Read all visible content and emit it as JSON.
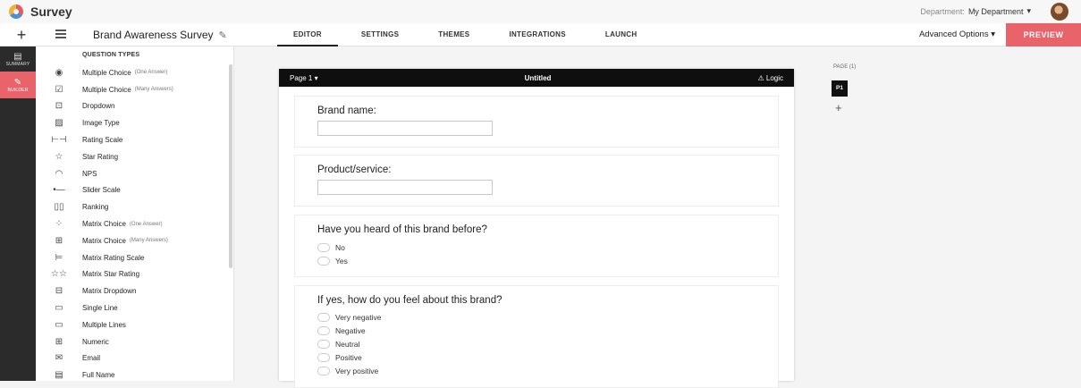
{
  "app": {
    "name": "Survey",
    "department_label": "Department:",
    "department_value": "My Department",
    "department_caret": "▾"
  },
  "navbar": {
    "add_glyph": "+",
    "survey_title": "Brand Awareness Survey",
    "edit_glyph": "✎",
    "tabs": [
      {
        "label": "EDITOR",
        "active": true
      },
      {
        "label": "SETTINGS",
        "active": false
      },
      {
        "label": "THEMES",
        "active": false
      },
      {
        "label": "INTEGRATIONS",
        "active": false
      },
      {
        "label": "LAUNCH",
        "active": false
      }
    ],
    "advanced_options": "Advanced Options ▾",
    "preview_label": "PREVIEW"
  },
  "rail": {
    "items": [
      {
        "label": "SUMMARY",
        "glyph": "▤",
        "active": false
      },
      {
        "label": "BUILDER",
        "glyph": "✎",
        "active": true
      }
    ]
  },
  "question_types": {
    "heading": "QUESTION TYPES",
    "items": [
      {
        "icon": "◉",
        "label": "Multiple Choice",
        "hint": "(One Answer)"
      },
      {
        "icon": "☑",
        "label": "Multiple Choice",
        "hint": "(Many Answers)"
      },
      {
        "icon": "⊡",
        "label": "Dropdown",
        "hint": ""
      },
      {
        "icon": "▨",
        "label": "Image Type",
        "hint": ""
      },
      {
        "icon": "⊢⊣",
        "label": "Rating Scale",
        "hint": ""
      },
      {
        "icon": "☆",
        "label": "Star Rating",
        "hint": ""
      },
      {
        "icon": "◠",
        "label": "NPS",
        "hint": ""
      },
      {
        "icon": "•—",
        "label": "Slider Scale",
        "hint": ""
      },
      {
        "icon": "▯▯",
        "label": "Ranking",
        "hint": ""
      },
      {
        "icon": "⁘",
        "label": "Matrix Choice",
        "hint": "(One Answer)"
      },
      {
        "icon": "⊞",
        "label": "Matrix Choice",
        "hint": "(Many Answers)"
      },
      {
        "icon": "⊨",
        "label": "Matrix Rating Scale",
        "hint": ""
      },
      {
        "icon": "☆☆",
        "label": "Matrix Star Rating",
        "hint": ""
      },
      {
        "icon": "⊟",
        "label": "Matrix Dropdown",
        "hint": ""
      },
      {
        "icon": "▭",
        "label": "Single Line",
        "hint": ""
      },
      {
        "icon": "▭",
        "label": "Multiple Lines",
        "hint": ""
      },
      {
        "icon": "⊞",
        "label": "Numeric",
        "hint": ""
      },
      {
        "icon": "✉",
        "label": "Email",
        "hint": ""
      },
      {
        "icon": "▤",
        "label": "Full Name",
        "hint": ""
      }
    ]
  },
  "page": {
    "selector": "Page 1 ▾",
    "title": "Untitled",
    "logic_label": "⚠ Logic"
  },
  "questions": [
    {
      "text": "Brand name:",
      "type": "text"
    },
    {
      "text": "Product/service:",
      "type": "text"
    },
    {
      "text": "Have you heard of this brand before?",
      "type": "choice",
      "options": [
        "No",
        "Yes"
      ]
    },
    {
      "text": "If yes, how do you feel about this brand?",
      "type": "choice",
      "options": [
        "Very negative",
        "Negative",
        "Neutral",
        "Positive",
        "Very positive"
      ]
    }
  ],
  "pages_panel": {
    "label": "PAGE (1)",
    "current": "P1",
    "add_glyph": "+"
  }
}
